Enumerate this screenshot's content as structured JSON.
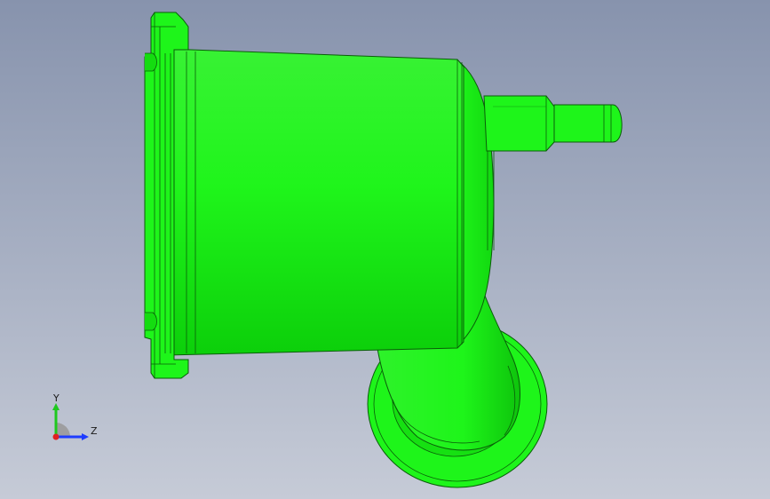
{
  "view": {
    "model_color": "#1ef51a",
    "background_top": "#8793ad",
    "background_bottom": "#c6cbd7"
  },
  "triad": {
    "y_label": "Y",
    "z_label": "Z",
    "y_color": "#1ec81e",
    "z_color": "#1e3cff",
    "origin_color": "#e02020"
  }
}
